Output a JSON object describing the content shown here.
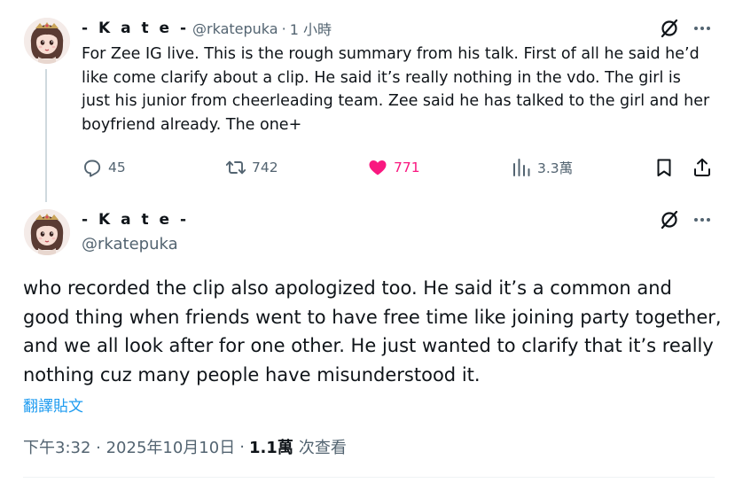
{
  "tweet1": {
    "display_name": "- K a t e -",
    "handle": "@rkatepuka",
    "separator": "·",
    "time": "1 小時",
    "text": "For Zee IG live. This is the rough summary from his talk. First of all he said he’d like come clarify about a clip. He said it’s really nothing in the vdo. The girl is just his junior from cheerleading team. Zee said he has talked to the girl and her boyfriend already. The one+",
    "actions": {
      "replies": "45",
      "retweets": "742",
      "likes": "771",
      "views": "3.3萬"
    }
  },
  "tweet2": {
    "display_name": "- K a t e -",
    "handle": "@rkatepuka",
    "text": "who recorded the clip also apologized too. He said it’s a common and good thing when friends went to have free time like joining party together, and we all look after for one other. He just wanted to clarify that it’s really nothing cuz many people have misunderstood it.",
    "translate_label": "翻譯貼文",
    "timestamp": "下午3:32 · 2025年10月10日",
    "meta_separator": "·",
    "views_count": "1.1萬",
    "views_label": "次查看"
  },
  "colors": {
    "text": "#0f1419",
    "secondary": "#536471",
    "like": "#f91880",
    "link": "#1d9bf0",
    "thread_line": "#cfd9de"
  },
  "icons": {
    "reply": "comment-bubble-icon",
    "retweet": "retweet-arrows-icon",
    "like": "heart-filled-icon",
    "views": "bar-chart-icon",
    "bookmark": "bookmark-icon",
    "share": "share-upload-icon",
    "grok": "grok-slash-circle-icon",
    "more": "more-dots-icon"
  }
}
